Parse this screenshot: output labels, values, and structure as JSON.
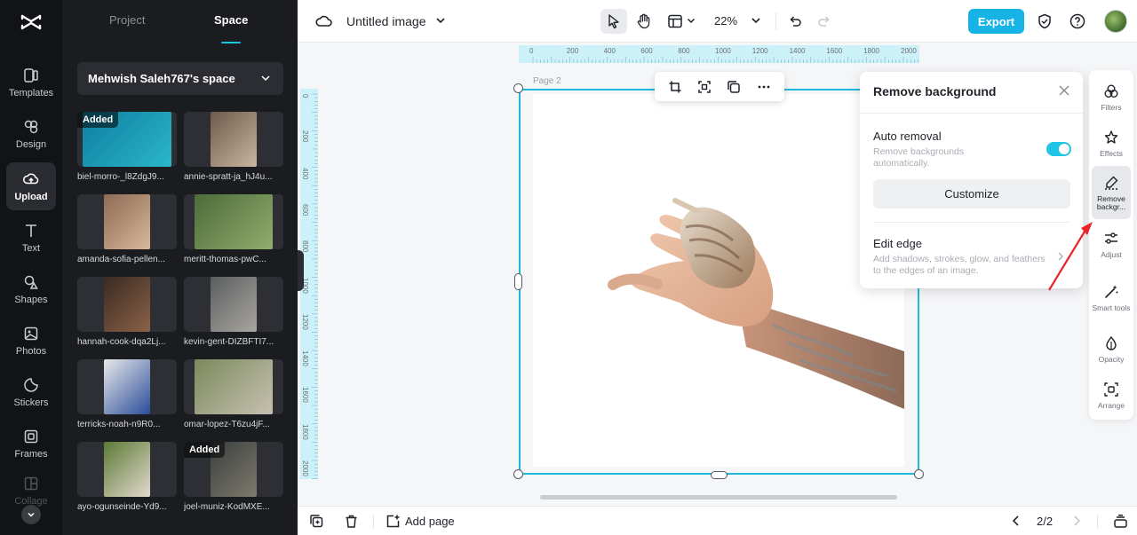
{
  "rail": {
    "items": [
      {
        "label": "Templates",
        "icon": "templates-icon"
      },
      {
        "label": "Design",
        "icon": "design-icon"
      },
      {
        "label": "Upload",
        "icon": "upload-icon",
        "active": true
      },
      {
        "label": "Text",
        "icon": "text-icon"
      },
      {
        "label": "Shapes",
        "icon": "shapes-icon"
      },
      {
        "label": "Photos",
        "icon": "photos-icon"
      },
      {
        "label": "Stickers",
        "icon": "stickers-icon"
      },
      {
        "label": "Frames",
        "icon": "frames-icon"
      },
      {
        "label": "Collage",
        "icon": "collage-icon"
      }
    ]
  },
  "panel": {
    "tabs": [
      "Project",
      "Space"
    ],
    "active_tab": "Space",
    "space_name": "Mehwish Saleh767's space",
    "badge": "Added",
    "thumbnails": [
      {
        "name": "biel-morro-_l8ZdgJ9...",
        "added": true,
        "colors": [
          "#0e7ea0",
          "#2bb7c9"
        ]
      },
      {
        "name": "annie-spratt-ja_hJ4u...",
        "added": false,
        "colors": [
          "#6f5a4a",
          "#c9b59f"
        ]
      },
      {
        "name": "amanda-sofia-pellen...",
        "added": false,
        "colors": [
          "#8d6b55",
          "#d9b79a"
        ]
      },
      {
        "name": "meritt-thomas-pwC...",
        "added": false,
        "colors": [
          "#4e6b3a",
          "#8fae6c"
        ]
      },
      {
        "name": "hannah-cook-dqa2Lj...",
        "added": false,
        "colors": [
          "#3a2a22",
          "#8b6248"
        ]
      },
      {
        "name": "kevin-gent-DIZBFTI7...",
        "added": false,
        "colors": [
          "#5a5d5f",
          "#a9a6a0"
        ]
      },
      {
        "name": "terricks-noah-n9R0...",
        "added": false,
        "colors": [
          "#e9e9ea",
          "#2a4d9a"
        ]
      },
      {
        "name": "omar-lopez-T6zu4jF...",
        "added": false,
        "colors": [
          "#7b8a5d",
          "#c6c0b0"
        ]
      },
      {
        "name": "ayo-ogunseinde-Yd9...",
        "added": false,
        "colors": [
          "#5c7a35",
          "#e3d9cf"
        ]
      },
      {
        "name": "joel-muniz-KodMXE...",
        "added": true,
        "colors": [
          "#3b3f3e",
          "#7d7a6e"
        ]
      }
    ]
  },
  "topbar": {
    "title": "Untitled image",
    "zoom": "22%",
    "export_label": "Export"
  },
  "canvas": {
    "page_label": "Page 2",
    "ruler_h": [
      "0",
      "200",
      "400",
      "600",
      "800",
      "1000",
      "1200",
      "1400",
      "1600",
      "1800",
      "2000"
    ],
    "ruler_v": [
      "0",
      "200",
      "400",
      "600",
      "800",
      "1000",
      "1200",
      "1400",
      "1600",
      "1800",
      "2000"
    ]
  },
  "remove_bg": {
    "title": "Remove background",
    "auto_title": "Auto removal",
    "auto_sub": "Remove backgrounds automatically.",
    "auto_on": true,
    "customize_label": "Customize",
    "edge_title": "Edit edge",
    "edge_sub": "Add shadows, strokes, glow, and feathers to the edges of an image."
  },
  "right_tools": [
    {
      "label": "Filters",
      "icon": "filters-icon"
    },
    {
      "label": "Effects",
      "icon": "effects-icon"
    },
    {
      "label": "Remove backgr...",
      "icon": "remove-background-icon",
      "active": true
    },
    {
      "label": "Adjust",
      "icon": "adjust-icon"
    },
    {
      "label": "Smart tools",
      "icon": "smart-tools-icon"
    },
    {
      "label": "Opacity",
      "icon": "opacity-icon"
    },
    {
      "label": "Arrange",
      "icon": "arrange-icon"
    }
  ],
  "bottombar": {
    "add_page_label": "Add page",
    "page_count": "2/2"
  },
  "colors": {
    "accent": "#1fc4e6",
    "export": "#15b4e5",
    "rail_bg": "#121316",
    "panel_bg": "#1b1c20",
    "arrow": "#e8252b"
  }
}
